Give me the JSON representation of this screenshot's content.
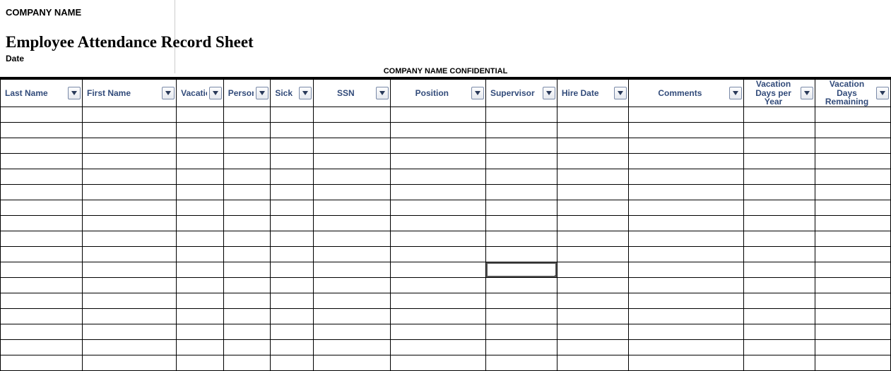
{
  "header": {
    "company_name": "COMPANY NAME",
    "title": "Employee Attendance Record Sheet",
    "date_label": "Date",
    "confidential": "COMPANY NAME CONFIDENTIAL"
  },
  "columns": [
    {
      "key": "last_name",
      "label": "Last Name",
      "class": "c-lastname",
      "align": "left"
    },
    {
      "key": "first_name",
      "label": "First Name",
      "class": "c-firstname",
      "align": "left"
    },
    {
      "key": "vacation",
      "label": "Vacation",
      "class": "c-vacation",
      "align": "left"
    },
    {
      "key": "personal",
      "label": "Personal",
      "class": "c-personal",
      "align": "left"
    },
    {
      "key": "sick",
      "label": "Sick",
      "class": "c-sick",
      "align": "left"
    },
    {
      "key": "ssn",
      "label": "SSN",
      "class": "c-ssn",
      "align": "center"
    },
    {
      "key": "position",
      "label": "Position",
      "class": "c-position",
      "align": "center"
    },
    {
      "key": "supervisor",
      "label": "Supervisor",
      "class": "c-supervisor",
      "align": "left"
    },
    {
      "key": "hire_date",
      "label": "Hire Date",
      "class": "c-hiredate",
      "align": "left"
    },
    {
      "key": "comments",
      "label": "Comments",
      "class": "c-comments",
      "align": "center"
    },
    {
      "key": "vac_per_year",
      "label": "Vacation Days per Year",
      "class": "c-vacyear",
      "align": "center",
      "multiline": true
    },
    {
      "key": "vac_remaining",
      "label": "Vacation Days Remaining",
      "class": "c-vacremain",
      "align": "center",
      "multiline": true
    }
  ],
  "row_count": 17,
  "selected_cell": {
    "row": 10,
    "col": 7
  }
}
